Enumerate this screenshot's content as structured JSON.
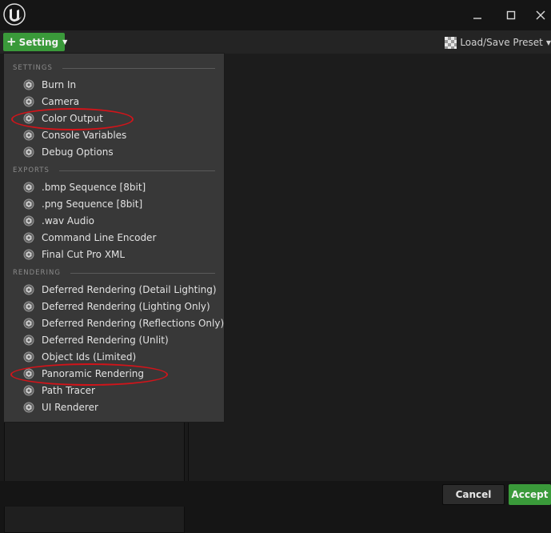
{
  "window": {
    "logo_icon": "unreal-engine-logo",
    "minimize_icon": "minimize-icon",
    "maximize_icon": "maximize-icon",
    "close_icon": "close-icon"
  },
  "toolbar": {
    "setting_label": "Setting",
    "preset_label": "Load/Save Preset"
  },
  "menu": {
    "sections": [
      {
        "title": "SETTINGS",
        "items": [
          "Burn In",
          "Camera",
          "Color Output",
          "Console Variables",
          "Debug Options"
        ]
      },
      {
        "title": "EXPORTS",
        "items": [
          ".bmp Sequence [8bit]",
          ".png Sequence [8bit]",
          ".wav Audio",
          "Command Line Encoder",
          "Final Cut Pro XML"
        ]
      },
      {
        "title": "RENDERING",
        "items": [
          "Deferred Rendering (Detail Lighting)",
          "Deferred Rendering (Lighting Only)",
          "Deferred Rendering (Reflections Only)",
          "Deferred Rendering (Unlit)",
          "Object Ids (Limited)",
          "Panoramic Rendering",
          "Path Tracer",
          "UI Renderer"
        ]
      }
    ]
  },
  "footer": {
    "cancel_label": "Cancel",
    "accept_label": "Accept"
  },
  "colors": {
    "accent_green": "#3a9a3a",
    "highlight_red": "#d2141a",
    "menu_bg": "#383838"
  }
}
